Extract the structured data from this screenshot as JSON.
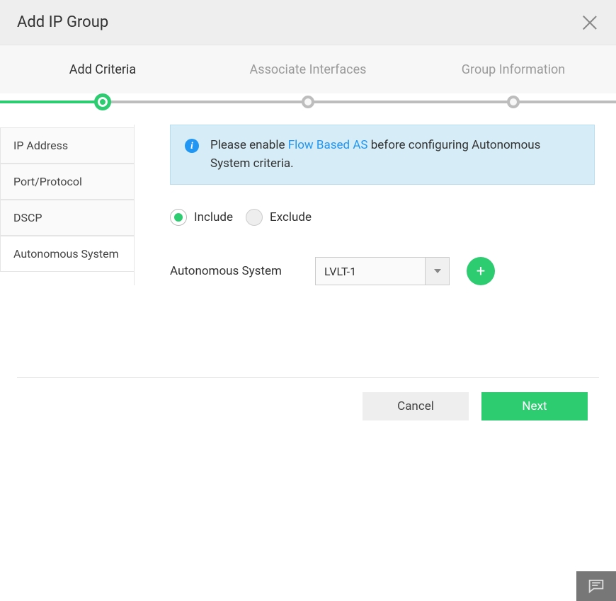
{
  "header": {
    "title": "Add IP Group"
  },
  "steps": {
    "items": [
      {
        "label": "Add Criteria",
        "active": true
      },
      {
        "label": "Associate Interfaces",
        "active": false
      },
      {
        "label": "Group Information",
        "active": false
      }
    ]
  },
  "sidebar": {
    "items": [
      {
        "label": "IP Address"
      },
      {
        "label": "Port/Protocol"
      },
      {
        "label": "DSCP"
      },
      {
        "label": "Autonomous System"
      }
    ],
    "selected_index": 3
  },
  "alert": {
    "prefix": "Please enable ",
    "link_text": "Flow Based AS",
    "suffix": " before configuring Autonomous System criteria."
  },
  "filter": {
    "include_label": "Include",
    "exclude_label": "Exclude",
    "selected": "include"
  },
  "form": {
    "as_label": "Autonomous System",
    "as_select_value": "LVLT-1"
  },
  "footer": {
    "cancel_label": "Cancel",
    "next_label": "Next"
  },
  "icons": {
    "close": "close-icon",
    "info": "info-icon",
    "add": "plus-icon",
    "chat": "chat-icon"
  }
}
